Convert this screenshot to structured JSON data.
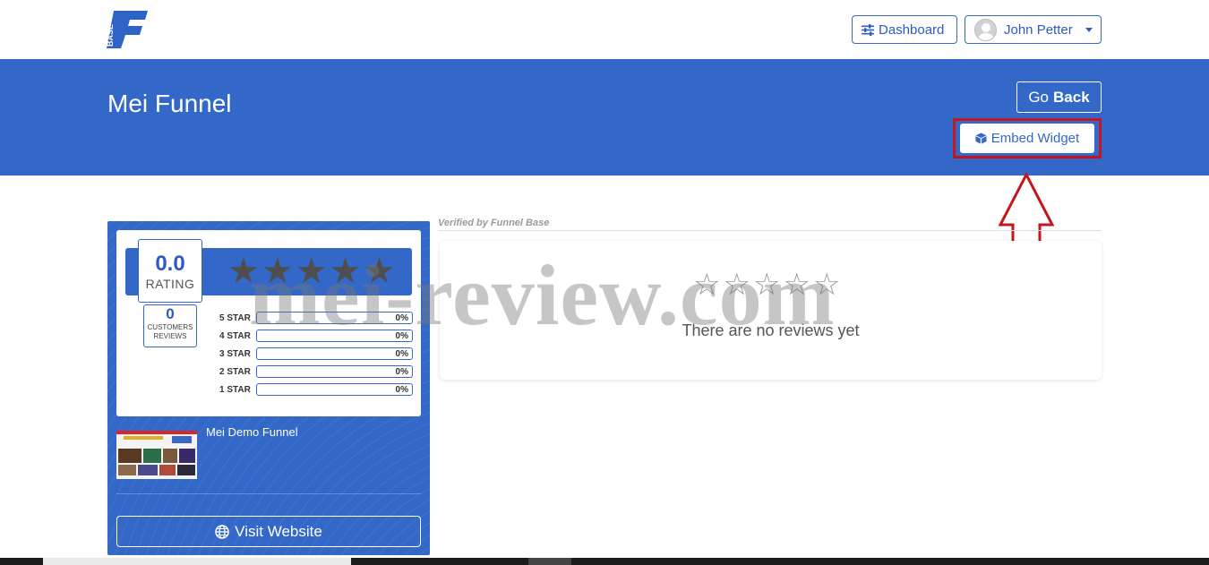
{
  "nav": {
    "logo_text": "BASE",
    "dashboard_label": "Dashboard",
    "user_name": "John Petter"
  },
  "header": {
    "title": "Mei Funnel",
    "go_back_prefix": "Go",
    "go_back_bold": "Back",
    "embed_label": "Embed Widget"
  },
  "summary": {
    "rating_value": "0.0",
    "rating_label": "RATING",
    "customer_count": "0",
    "customer_label_1": "CUSTOMERS",
    "customer_label_2": "REVIEWS",
    "breakdown": [
      {
        "label": "5 STAR",
        "pct": "0%"
      },
      {
        "label": "4 STAR",
        "pct": "0%"
      },
      {
        "label": "3 STAR",
        "pct": "0%"
      },
      {
        "label": "2 STAR",
        "pct": "0%"
      },
      {
        "label": "1 STAR",
        "pct": "0%"
      }
    ],
    "funnel_name": "Mei Demo Funnel",
    "visit_label": "Visit Website"
  },
  "reviews": {
    "verified_prefix": "Verified by",
    "verified_brand": "Funnel Base",
    "empty_text": "There are no reviews yet"
  },
  "watermark": "mei-review.com",
  "colors": {
    "brand_blue": "#3368c9",
    "highlight_red": "#c4161c"
  }
}
